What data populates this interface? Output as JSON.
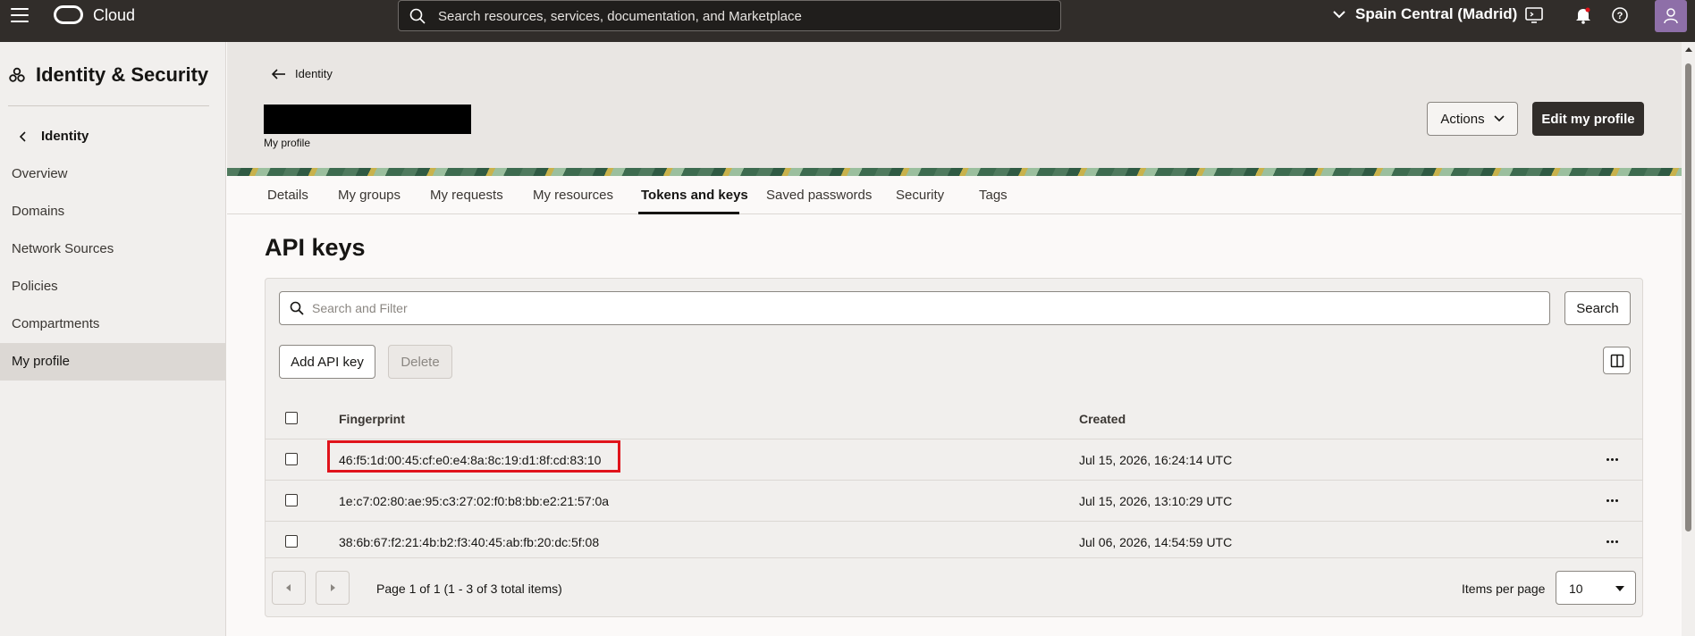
{
  "topbar": {
    "brand": "Cloud",
    "search_placeholder": "Search resources, services, documentation, and Marketplace",
    "region": "Spain Central (Madrid)"
  },
  "sidebar": {
    "title": "Identity & Security",
    "back_label": "Identity",
    "items": [
      {
        "label": "Overview"
      },
      {
        "label": "Domains"
      },
      {
        "label": "Network Sources"
      },
      {
        "label": "Policies"
      },
      {
        "label": "Compartments"
      },
      {
        "label": "My profile",
        "active": true
      }
    ]
  },
  "header": {
    "breadcrumb": "Identity",
    "subtitle": "My profile",
    "actions_label": "Actions",
    "edit_label": "Edit my profile"
  },
  "tabs": [
    {
      "label": "Details"
    },
    {
      "label": "My groups"
    },
    {
      "label": "My requests"
    },
    {
      "label": "My resources"
    },
    {
      "label": "Tokens and keys",
      "active": true
    },
    {
      "label": "Saved passwords"
    },
    {
      "label": "Security"
    },
    {
      "label": "Tags"
    }
  ],
  "main": {
    "heading": "API keys",
    "filter_placeholder": "Search and Filter",
    "search_label": "Search",
    "add_label": "Add API key",
    "delete_label": "Delete",
    "columns": {
      "fingerprint": "Fingerprint",
      "created": "Created"
    },
    "rows": [
      {
        "fingerprint": "46:f5:1d:00:45:cf:e0:e4:8a:8c:19:d1:8f:cd:83:10",
        "created": "Jul 15, 2026, 16:24:14 UTC",
        "highlighted": true
      },
      {
        "fingerprint": "1e:c7:02:80:ae:95:c3:27:02:f0:b8:bb:e2:21:57:0a",
        "created": "Jul 15, 2026, 13:10:29 UTC"
      },
      {
        "fingerprint": "38:6b:67:f2:21:4b:b2:f3:40:45:ab:fb:20:dc:5f:08",
        "created": "Jul 06, 2026, 14:54:59 UTC"
      }
    ],
    "pagination": {
      "page_text": "Page 1 of 1 (1 - 3 of 3 total items)",
      "items_per_page_label": "Items per page",
      "items_per_page": "10"
    }
  },
  "colors": {
    "topbar_bg": "#312d2a",
    "highlight_border": "#e0131b",
    "primary_button": "#312d2a"
  }
}
